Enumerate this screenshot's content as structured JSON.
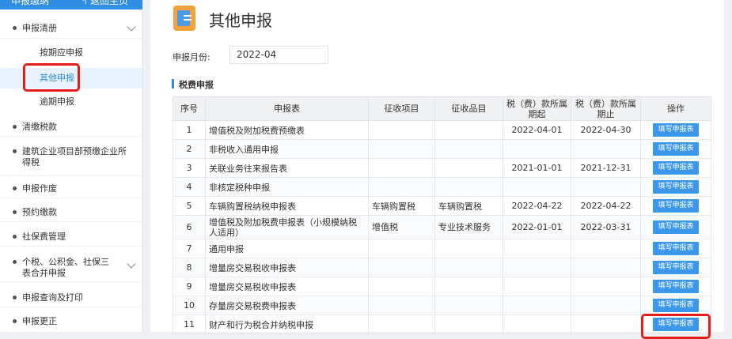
{
  "sidebar": {
    "header_title": "申报缴纳",
    "back_label": "返回主页",
    "items": [
      {
        "label": "申报清册",
        "chevron": true
      },
      {
        "label": "清缴税款"
      },
      {
        "label": "建筑企业项目部预缴企业所得税"
      },
      {
        "label": "申报作废"
      },
      {
        "label": "预约缴款"
      },
      {
        "label": "社保费管理"
      },
      {
        "label": "个税、公积金、社保三表合并申报",
        "chevron": true
      },
      {
        "label": "申报查询及打印"
      },
      {
        "label": "申报更正"
      }
    ],
    "sub_items": [
      {
        "label": "按期应申报"
      },
      {
        "label": "其他申报",
        "active": true
      },
      {
        "label": "逾期申报"
      }
    ]
  },
  "main": {
    "title": "其他申报",
    "month_label": "申报月份:",
    "month_value": "2022-04",
    "section_title": "税费申报"
  },
  "table": {
    "headers": [
      "序号",
      "申报表",
      "征收项目",
      "征收品目",
      "税（费）款所属期起",
      "税（费）款所属期止",
      "操作"
    ],
    "button_label": "填写申报表",
    "rows": [
      {
        "no": "1",
        "name": "增值税及附加税费预缴表",
        "item": "",
        "sub": "",
        "start": "2022-04-01",
        "end": "2022-04-30"
      },
      {
        "no": "2",
        "name": "非税收入通用申报",
        "item": "",
        "sub": "",
        "start": "",
        "end": ""
      },
      {
        "no": "3",
        "name": "关联业务往来报告表",
        "item": "",
        "sub": "",
        "start": "2021-01-01",
        "end": "2021-12-31"
      },
      {
        "no": "4",
        "name": "非核定税种申报",
        "item": "",
        "sub": "",
        "start": "",
        "end": ""
      },
      {
        "no": "5",
        "name": "车辆购置税纳税申报表",
        "item": "车辆购置税",
        "sub": "车辆购置税",
        "start": "2022-04-22",
        "end": "2022-04-22"
      },
      {
        "no": "6",
        "name": "增值税及附加税费申报表（小规模纳税人适用）",
        "item": "增值税",
        "sub": "专业技术服务",
        "start": "2022-01-01",
        "end": "2022-03-31"
      },
      {
        "no": "7",
        "name": "通用申报",
        "item": "",
        "sub": "",
        "start": "",
        "end": ""
      },
      {
        "no": "8",
        "name": "增量房交易税收申报表",
        "item": "",
        "sub": "",
        "start": "",
        "end": ""
      },
      {
        "no": "9",
        "name": "增量房交易税收申报表",
        "item": "",
        "sub": "",
        "start": "",
        "end": ""
      },
      {
        "no": "10",
        "name": "存量房交易税费申报表",
        "item": "",
        "sub": "",
        "start": "",
        "end": ""
      },
      {
        "no": "11",
        "name": "财产和行为税合并纳税申报",
        "item": "",
        "sub": "",
        "start": "",
        "end": ""
      }
    ]
  }
}
